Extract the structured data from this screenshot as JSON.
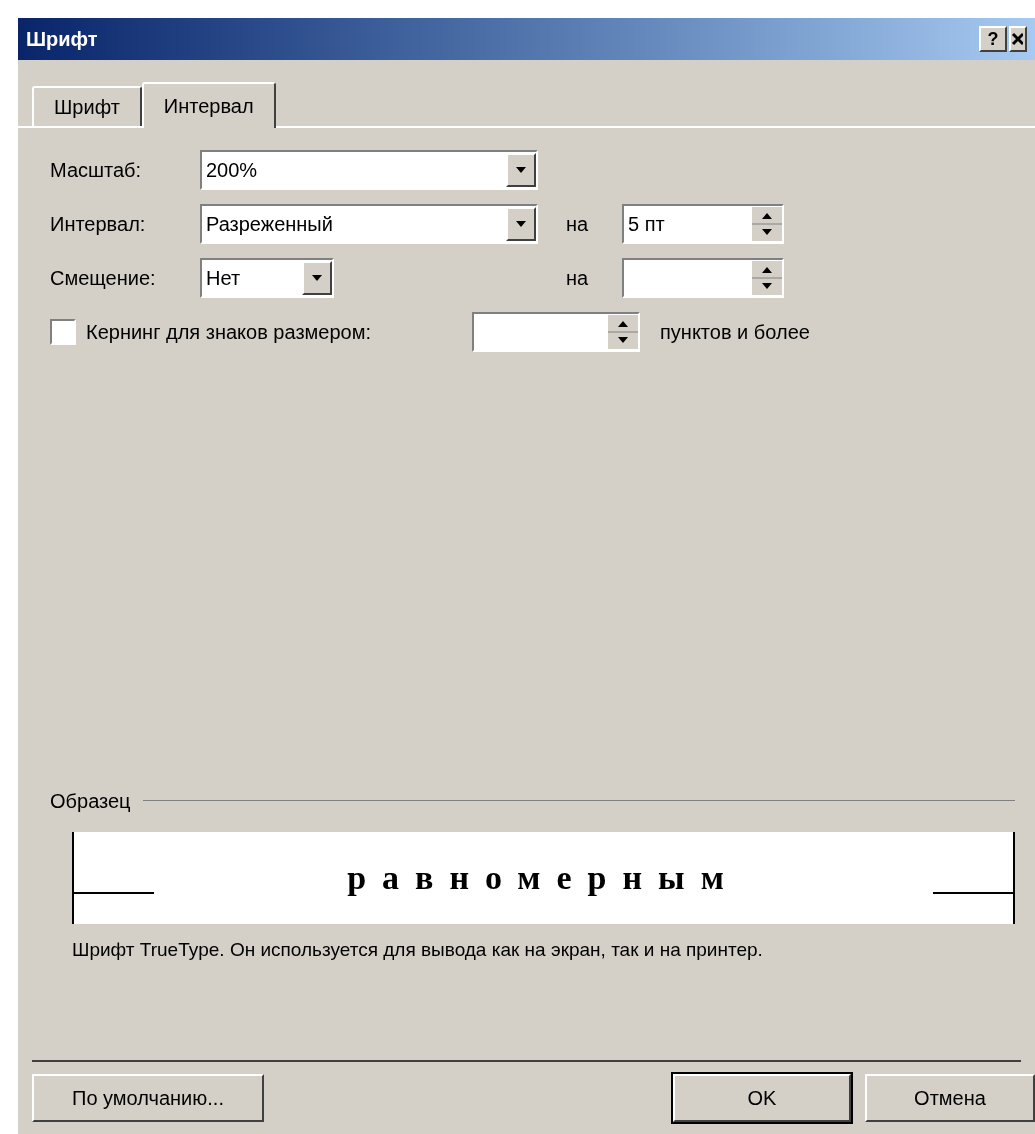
{
  "window": {
    "title": "Шрифт",
    "help": "?"
  },
  "tabs": [
    {
      "label": "Шрифт",
      "selected": false
    },
    {
      "label": "Интервал",
      "selected": true
    }
  ],
  "scale": {
    "label": "Масштаб:",
    "value": "200%"
  },
  "spacing": {
    "label": "Интервал:",
    "value": "Разреженный",
    "by_label": "на",
    "by_value": "5 пт"
  },
  "position": {
    "label": "Смещение:",
    "value": "Нет",
    "by_label": "на"
  },
  "kerning": {
    "label": "Кернинг для знаков размером:",
    "checked": false,
    "suffix": "пунктов и более"
  },
  "preview": {
    "label": "Образец",
    "sample": "равномерным",
    "description": "Шрифт TrueType. Он используется для вывода как на экран, так и на принтер."
  },
  "buttons": [
    {
      "label": "По умолчанию...",
      "default": false
    },
    {
      "label": "OK",
      "default": true
    },
    {
      "label": "Отмена",
      "default": false
    }
  ]
}
